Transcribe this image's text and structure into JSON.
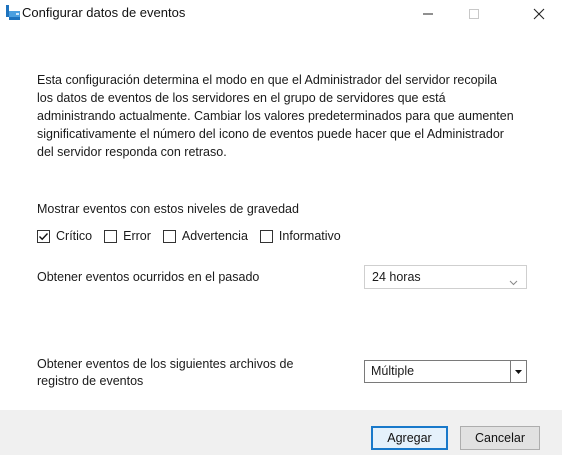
{
  "window": {
    "title": "Configurar datos de eventos"
  },
  "description": {
    "lines": [
      "Esta configuración determina el modo en que el Administrador del servidor recopila",
      "los datos de eventos de los servidores en el grupo de servidores que está",
      "administrando actualmente. Cambiar los valores predeterminados para que aumenten",
      "significativamente el número del icono de eventos puede hacer que el Administrador",
      "del servidor responda con retraso."
    ]
  },
  "severity": {
    "label": "Mostrar eventos con estos niveles de gravedad",
    "options": [
      {
        "label": "Crítico",
        "checked": true
      },
      {
        "label": "Error",
        "checked": false
      },
      {
        "label": "Advertencia",
        "checked": false
      },
      {
        "label": "Informativo",
        "checked": false
      }
    ]
  },
  "past": {
    "label": "Obtener eventos ocurridos en el pasado",
    "value": "24 horas"
  },
  "files": {
    "label_line1": "Obtener eventos de los siguientes archivos de",
    "label_line2": "registro de eventos",
    "value": "Múltiple"
  },
  "buttons": {
    "add": "Agregar",
    "cancel": "Cancelar"
  },
  "icons": {
    "app": "server-manager-icon",
    "minimize": "minimize-icon",
    "maximize": "maximize-icon",
    "close": "close-icon"
  },
  "colors": {
    "accent": "#1979ca",
    "footer_bg": "#f0f0f0"
  }
}
